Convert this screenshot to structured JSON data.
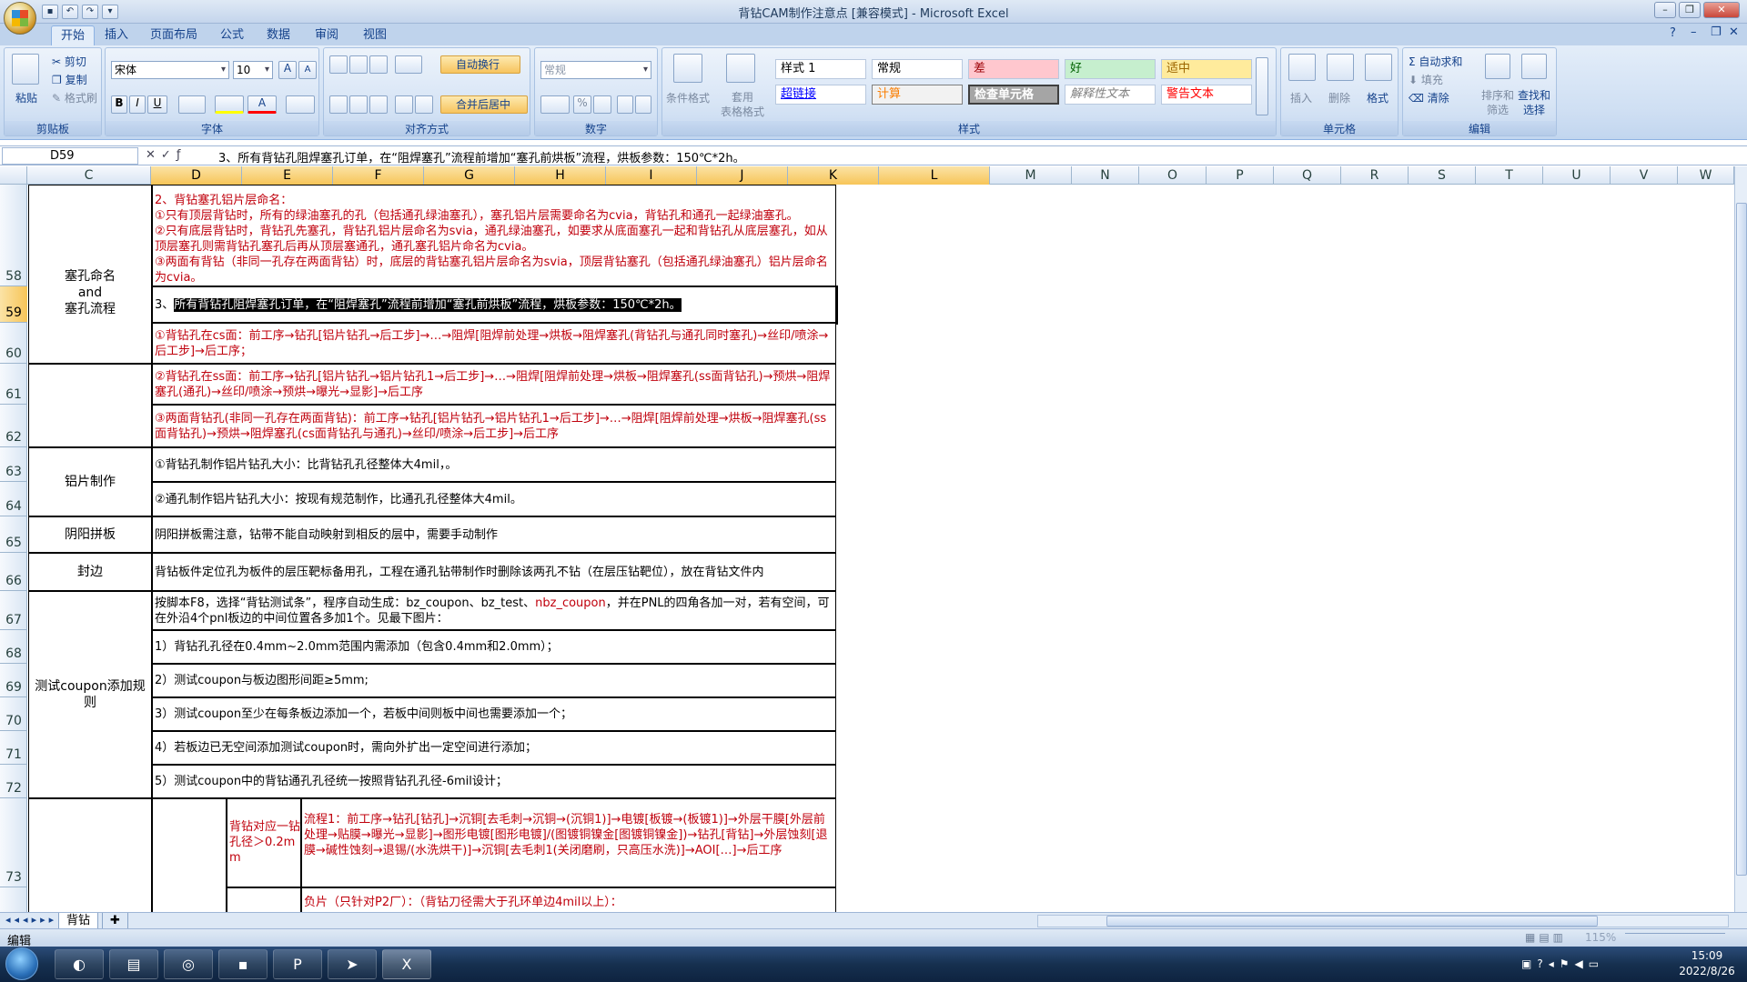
{
  "window": {
    "title": "背钻CAM制作注意点 [兼容模式] - Microsoft Excel"
  },
  "ribbon": {
    "tabs": [
      "开始",
      "插入",
      "页面布局",
      "公式",
      "数据",
      "审阅",
      "视图"
    ],
    "clipboard": {
      "paste": "粘贴",
      "cut": "剪切",
      "copy": "复制",
      "format_painter": "格式刷",
      "label": "剪贴板"
    },
    "font": {
      "name": "宋体",
      "size": "10",
      "label": "字体",
      "bold": "B",
      "italic": "I",
      "underline": "U"
    },
    "alignment": {
      "wrap": "自动换行",
      "merge": "合并后居中",
      "label": "对齐方式"
    },
    "number": {
      "format": "常规",
      "percent": "%",
      "label": "数字"
    },
    "styles": {
      "conditional": "条件格式",
      "table": "套用\n表格格式",
      "label": "样式",
      "cells": [
        "样式 1",
        "常规",
        "差",
        "好",
        "适中",
        "超链接",
        "计算",
        "检查单元格",
        "解释性文本",
        "警告文本"
      ]
    },
    "cells": {
      "insert": "插入",
      "delete": "删除",
      "format": "格式",
      "label": "单元格"
    },
    "editing": {
      "autosum": "自动求和",
      "fill": "填充",
      "clear": "清除",
      "sort": "排序和\n筛选",
      "find": "查找和\n选择",
      "label": "编辑"
    }
  },
  "formula_bar": {
    "name_box": "D59",
    "content": "3、所有背钻孔阻焊塞孔订单，在“阻焊塞孔”流程前增加“塞孔前烘板”流程，烘板参数：150℃*2h。"
  },
  "columns": [
    "C",
    "D",
    "E",
    "F",
    "G",
    "H",
    "I",
    "J",
    "K",
    "L",
    "M",
    "N",
    "O",
    "P",
    "Q",
    "R",
    "S",
    "T",
    "U",
    "V",
    "W"
  ],
  "rows": [
    "58",
    "59",
    "60",
    "61",
    "62",
    "63",
    "64",
    "65",
    "66",
    "67",
    "68",
    "69",
    "70",
    "71",
    "72",
    "73"
  ],
  "sheet": {
    "cat_plug": "塞孔命名\nand\n塞孔流程",
    "r58": "2、背钻塞孔铝片层命名：\n①只有顶层背钻时，所有的绿油塞孔的孔（包括通孔绿油塞孔），塞孔铝片层需要命名为cvia，背钻孔和通孔一起绿油塞孔。\n②只有底层背钻时，背钻孔先塞孔，背钻孔铝片层命名为svia，通孔绿油塞孔，如要求从底面塞孔一起和背钻孔从底层塞孔，如从顶层塞孔则需背钻孔塞孔后再从顶层塞通孔，通孔塞孔铝片命名为cvia。\n③两面有背钻（非同一孔存在两面背钻）时，底层的背钻塞孔铝片层命名为svia，顶层背钻塞孔（包括通孔绿油塞孔）铝片层命名为cvia。",
    "r59_prefix": "3、",
    "r59": "所有背钻孔阻焊塞孔订单，在“阻焊塞孔”流程前增加“塞孔前烘板”流程，烘板参数：150℃*2h。",
    "r60": "①背钻孔在cs面：前工序→钻孔[铝片钻孔→后工步]→…→阻焊[阻焊前处理→烘板→阻焊塞孔(背钻孔与通孔同时塞孔)→丝印/喷涂→后工步]→后工序；",
    "r61": "②背钻孔在ss面：前工序→钻孔[铝片钻孔→铝片钻孔1→后工步]→…→阻焊[阻焊前处理→烘板→阻焊塞孔(ss面背钻孔)→预烘→阻焊塞孔(通孔)→丝印/喷涂→预烘→曝光→显影]→后工序",
    "r62": "③两面背钻孔(非同一孔存在两面背钻)：前工序→钻孔[铝片钻孔→铝片钻孔1→后工步]→…→阻焊[阻焊前处理→烘板→阻焊塞孔(ss面背钻孔)→预烘→阻焊塞孔(cs面背钻孔与通孔)→丝印/喷涂→后工步]→后工序",
    "cat_alum": "铝片制作",
    "r63": "①背钻孔制作铝片钻孔大小：比背钻孔孔径整体大4mil，。",
    "r64": "②通孔制作铝片钻孔大小：按现有规范制作，比通孔孔径整体大4mil。",
    "cat_yinyang": "阴阳拼板",
    "r65": "阴阳拼板需注意，钻带不能自动映射到相反的层中，需要手动制作",
    "cat_seal": "封边",
    "r66": "背钻板件定位孔为板件的层压靶标备用孔，工程在通孔钻带制作时删除该两孔不钻（在层压钻靶位），放在背钻文件内",
    "cat_coupon": "测试coupon添加规则",
    "r67a": "按脚本F8，选择“背钻测试条”，程序自动生成：bz_coupon、bz_test、",
    "r67red": "nbz_coupon",
    "r67b": "，并在PNL的四角各加一对，若有空间，可在外沿4个pnl板边的中间位置各多加1个。见最下图片：",
    "r68": "1）背钻孔孔径在0.4mm~2.0mm范围内需添加（包含0.4mm和2.0mm）；",
    "r69": "2）测试coupon与板边图形间距≥5mm;",
    "r70": "3）测试coupon至少在每条板边添加一个，若板中间则板中间也需要添加一个；",
    "r71": "4）若板边已无空间添加测试coupon时，需向外扩出一定空间进行添加；",
    "r72": "5）测试coupon中的背钻通孔孔径统一按照背钻孔孔径-6mil设计；",
    "r73_label": "背钻对应一钻孔径＞0.2mm",
    "r73": "流程1：前工序→钻孔[钻孔]→沉铜[去毛刺→沉铜→(沉铜1)]→电镀[板镀→(板镀1)]→外层干膜[外层前处理→贴膜→曝光→显影]→图形电镀[图形电镀]/(图镀铜镍金[图镀铜镍金])→钻孔[背钻]→外层蚀刻[退膜→碱性蚀刻→退锡/(水洗烘干)]→沉铜[去毛刺1(关闭磨刷，只高压水洗)]→AOI[…]→后工序",
    "r74": "负片（只针对P2厂）：（背钻刀径需大于孔环单边4mil以上）："
  },
  "sheet_tab": "背钻",
  "status": {
    "mode": "编辑",
    "zoom": "115%"
  },
  "taskbar": {
    "time": "15:09",
    "date": "2022/8/26"
  }
}
